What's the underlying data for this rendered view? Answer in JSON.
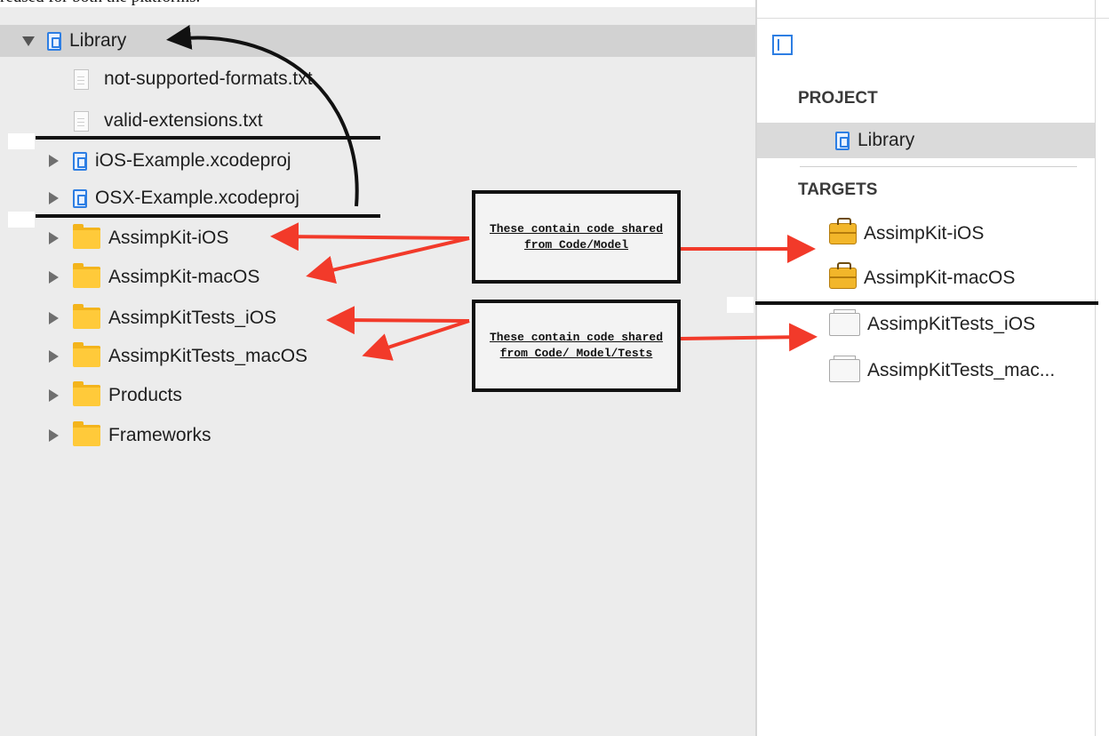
{
  "caption": "reused for both the platforms.",
  "navigator": {
    "items": [
      {
        "label": "Library"
      },
      {
        "label": "not-supported-formats.txt"
      },
      {
        "label": "valid-extensions.txt"
      },
      {
        "label": "iOS-Example.xcodeproj"
      },
      {
        "label": "OSX-Example.xcodeproj"
      },
      {
        "label": "AssimpKit-iOS"
      },
      {
        "label": "AssimpKit-macOS"
      },
      {
        "label": "AssimpKitTests_iOS"
      },
      {
        "label": "AssimpKitTests_macOS"
      },
      {
        "label": "Products"
      },
      {
        "label": "Frameworks"
      }
    ]
  },
  "inspector": {
    "project_header": "PROJECT",
    "project_item": "Library",
    "targets_header": "TARGETS",
    "targets": [
      {
        "label": "AssimpKit-iOS"
      },
      {
        "label": "AssimpKit-macOS"
      },
      {
        "label": "AssimpKitTests_iOS"
      },
      {
        "label": "AssimpKitTests_mac..."
      }
    ]
  },
  "annotations": {
    "box1": "These contain code shared from Code/Model",
    "box2": "These contain code shared from Code/ Model/Tests"
  },
  "colors": {
    "accent": "#2d7ee3",
    "arrow": "#f23a2a",
    "folder": "#ffca3a",
    "selection": "#d2d2d2"
  }
}
